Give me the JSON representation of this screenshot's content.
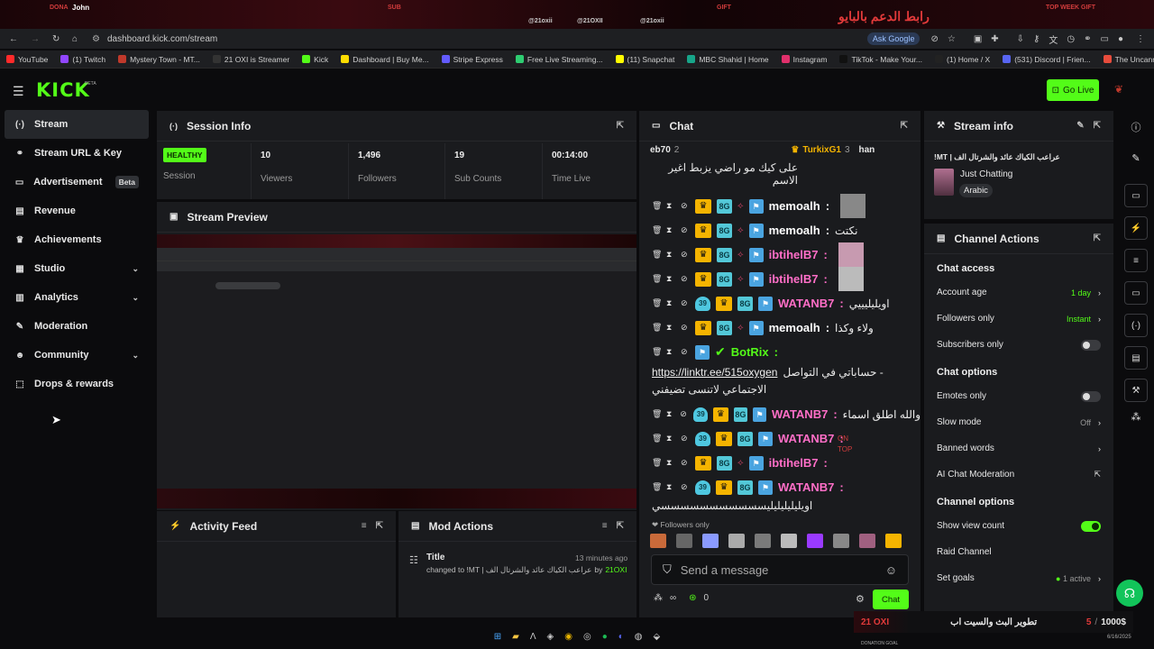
{
  "overlay": {
    "donor_label": "DONA",
    "donor_name": "John",
    "sub_label": "SUB",
    "gift_label": "GIFT",
    "top_label": "TOP WEEK GIFT",
    "arabic_banner": "رابط الدعم بالبايو",
    "handle1": "@21oxii",
    "handle2": "@21OXII",
    "handle3": "@21oxii"
  },
  "browser": {
    "url": "dashboard.kick.com/stream",
    "ask_google": "Ask Google",
    "bookmarks": [
      {
        "label": "YouTube",
        "color": "#ff2a2a"
      },
      {
        "label": "(1) Twitch",
        "color": "#9146ff"
      },
      {
        "label": "Mystery Town - MT...",
        "color": "#c0392b"
      },
      {
        "label": "21 OXI is Streamer",
        "color": "#333"
      },
      {
        "label": "Kick",
        "color": "#53fc18"
      },
      {
        "label": "Dashboard | Buy Me...",
        "color": "#ffdd00"
      },
      {
        "label": "Stripe Express",
        "color": "#635bff"
      },
      {
        "label": "Free Live Streaming...",
        "color": "#2ecc71"
      },
      {
        "label": "(11) Snapchat",
        "color": "#fffc00"
      },
      {
        "label": "MBC Shahid | Home",
        "color": "#17a589"
      },
      {
        "label": "Instagram",
        "color": "#e1306c"
      },
      {
        "label": "TikTok - Make Your...",
        "color": "#111"
      },
      {
        "label": "(1) Home / X",
        "color": "#222"
      },
      {
        "label": "(531) Discord | Frien...",
        "color": "#5865f2"
      },
      {
        "label": "The Uncanny Count...",
        "color": "#e74c3c"
      }
    ]
  },
  "header": {
    "logo": "KICK",
    "logo_sup": "BETA",
    "go_live": "Go Live"
  },
  "sidebar": {
    "items": [
      {
        "label": "Stream",
        "icon": "(·)"
      },
      {
        "label": "Stream URL & Key",
        "icon": "⚭"
      },
      {
        "label": "Advertisement",
        "icon": "▭"
      },
      {
        "label": "Revenue",
        "icon": "▤"
      },
      {
        "label": "Achievements",
        "icon": "♛"
      },
      {
        "label": "Studio",
        "icon": "▦"
      },
      {
        "label": "Analytics",
        "icon": "▥"
      },
      {
        "label": "Moderation",
        "icon": "✎"
      },
      {
        "label": "Community",
        "icon": "☻"
      },
      {
        "label": "Drops & rewards",
        "icon": "⬚"
      }
    ],
    "beta_badge": "Beta"
  },
  "session": {
    "title": "Session Info",
    "health": "HEALTHY",
    "health_label": "Session",
    "stats": [
      {
        "value": "10",
        "label": "Viewers"
      },
      {
        "value": "1,496",
        "label": "Followers"
      },
      {
        "value": "19",
        "label": "Sub Counts"
      },
      {
        "value": "00:14:00",
        "label": "Time Live"
      }
    ]
  },
  "preview": {
    "title": "Stream Preview"
  },
  "activity": {
    "title": "Activity Feed"
  },
  "mod_actions": {
    "title": "Mod Actions",
    "item_title": "Title",
    "item_time": "13 minutes ago",
    "item_text": "changed to !MT | عراعب الكياك عائد والشرتال الف",
    "item_by": "by",
    "item_user": "21OXI"
  },
  "chat": {
    "title": "Chat",
    "top_gifters": [
      "eb70",
      "2",
      "TurkixG1",
      "3",
      "han"
    ],
    "first_msg": "على كيك مو راضي يزبط اغير الاسم",
    "messages": [
      {
        "user": "memoalh",
        "text": "",
        "color": "#ffffff",
        "sub": "",
        "pic": "#888"
      },
      {
        "user": "memoalh",
        "text": "نكتت",
        "color": "#ffffff",
        "sub": "",
        "pic": ""
      },
      {
        "user": "ibtihelB7",
        "text": "",
        "color": "#ff6ec7",
        "sub": "",
        "pic": "#c79ab0"
      },
      {
        "user": "ibtihelB7",
        "text": "",
        "color": "#ff6ec7",
        "sub": "",
        "pic": "#bbb"
      },
      {
        "user": "WATANB7",
        "text": "اويليليييي",
        "color": "#ff6ec7",
        "sub": "39",
        "pic": ""
      },
      {
        "user": "memoalh",
        "text": "ولاء وكذا",
        "color": "#ffffff",
        "sub": "",
        "pic": ""
      }
    ],
    "botrix_user": "BotRix",
    "botrix_link": "https://linktr.ee/515oxygen",
    "botrix_text1": "حساباتي في التواصل -",
    "botrix_text2": "الاجتماعي لاتنسى تضيفني",
    "messages2": [
      {
        "user": "WATANB7",
        "text": "والله اطلق اسماء",
        "color": "#ff6ec7",
        "sub": "39"
      },
      {
        "user": "WATANB7",
        "text": "",
        "color": "#ff6ec7",
        "sub": "39"
      },
      {
        "user": "ibtihelB7",
        "text": "",
        "color": "#ff6ec7",
        "sub": ""
      },
      {
        "user": "WATANB7",
        "text": "",
        "color": "#ff6ec7",
        "sub": "39"
      }
    ],
    "last_msg": "اويليليليليليسسسسسسسسسسسي",
    "on_top": "ON TOP",
    "followers_only": "Followers only",
    "placeholder": "Send a message",
    "send": "Chat",
    "points": "0",
    "infinity": "∞"
  },
  "stream_info": {
    "title": "Stream info",
    "stream_title": "!MT | عراعب الكياك عائد والشرتال الف",
    "category": "Just Chatting",
    "language": "Arabic"
  },
  "channel_actions": {
    "title": "Channel Actions",
    "chat_access": "Chat access",
    "account_age": "Account age",
    "account_age_val": "1 day",
    "followers_only": "Followers only",
    "followers_only_val": "Instant",
    "subscribers_only": "Subscribers only",
    "chat_options": "Chat options",
    "emotes_only": "Emotes only",
    "slow_mode": "Slow mode",
    "slow_mode_val": "Off",
    "banned_words": "Banned words",
    "ai_mod": "AI Chat Moderation",
    "channel_options": "Channel options",
    "show_view_count": "Show view count",
    "raid_channel": "Raid Channel",
    "set_goals": "Set goals",
    "goals_val": "1 active"
  },
  "goal_overlay": {
    "brand": "21 OXI",
    "text": "تطوير البث والسيت اب",
    "current": "5",
    "target": "1000$",
    "label": "DONATION GOAL",
    "date": "6/16/2025"
  },
  "colors": {
    "accent": "#53fc18",
    "panel": "#1a1b1e",
    "bg": "#0b0b0d"
  }
}
